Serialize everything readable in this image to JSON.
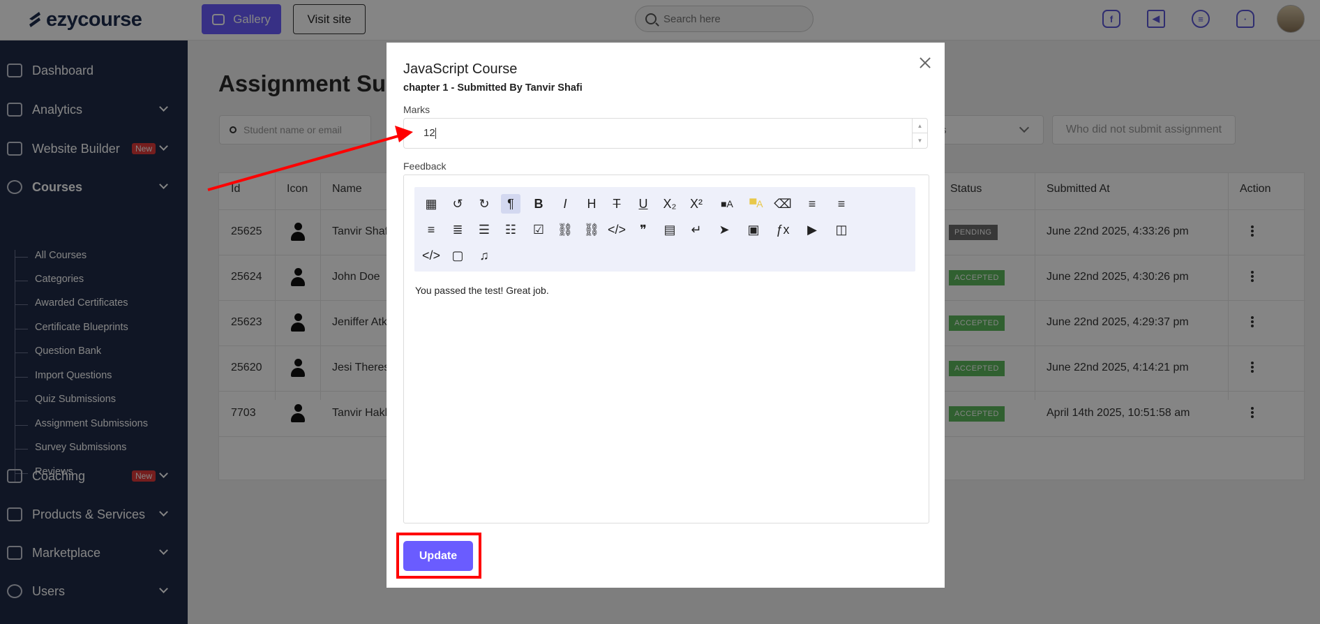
{
  "header": {
    "logo": "ezycourse",
    "gallery_label": "Gallery",
    "visit_label": "Visit site",
    "search_placeholder": "Search here",
    "icons": [
      "facebook-icon",
      "megaphone-icon",
      "chat-icon",
      "bell-icon"
    ]
  },
  "sidebar": {
    "items": [
      {
        "label": "Dashboard",
        "icon": "dashboard-icon"
      },
      {
        "label": "Analytics",
        "icon": "analytics-icon"
      },
      {
        "label": "Website Builder",
        "icon": "website-icon",
        "badge": "New"
      },
      {
        "label": "Courses",
        "icon": "courses-icon"
      },
      {
        "label": "Coaching",
        "icon": "coaching-icon",
        "badge": "New"
      },
      {
        "label": "Products & Services",
        "icon": "products-icon"
      },
      {
        "label": "Marketplace",
        "icon": "marketplace-icon"
      },
      {
        "label": "Users",
        "icon": "users-icon"
      }
    ],
    "course_subitems": [
      "All Courses",
      "Categories",
      "Awarded Certificates",
      "Certificate Blueprints",
      "Question Bank",
      "Import Questions",
      "Quiz Submissions",
      "Assignment Submissions",
      "Survey Submissions",
      "Reviews"
    ]
  },
  "main": {
    "title": "Assignment Subm",
    "filter_placeholder": "Student name or email",
    "filter_select": "s",
    "filter_button": "Who did not submit assignment",
    "table": {
      "headers": [
        "Id",
        "Icon",
        "Name",
        "Status",
        "Submitted At",
        "Action"
      ],
      "rows": [
        {
          "id": "25625",
          "name": "Tanvir Shafi",
          "status": "PENDING",
          "submitted": "June 22nd 2025, 4:33:26 pm"
        },
        {
          "id": "25624",
          "name": "John Doe",
          "status": "ACCEPTED",
          "submitted": "June 22nd 2025, 4:30:26 pm"
        },
        {
          "id": "25623",
          "name": "Jeniffer Atk",
          "status": "ACCEPTED",
          "submitted": "June 22nd 2025, 4:29:37 pm"
        },
        {
          "id": "25620",
          "name": "Jesi Theress",
          "status": "ACCEPTED",
          "submitted": "June 22nd 2025, 4:14:21 pm"
        },
        {
          "id": "7703",
          "name": "Tanvir Hakk",
          "status": "ACCEPTED",
          "submitted": "April 14th 2025, 10:51:58 am"
        }
      ]
    }
  },
  "modal": {
    "title": "JavaScript Course",
    "subtitle": "chapter 1 - Submitted By Tanvir Shafi",
    "marks_label": "Marks",
    "marks_value": "12",
    "feedback_label": "Feedback",
    "feedback_text": "You passed the test! Great job.",
    "update_label": "Update",
    "toolbar_buttons": [
      "table-icon",
      "undo-icon",
      "redo-icon",
      "paragraph-icon",
      "bold-icon",
      "italic-icon",
      "heading-icon",
      "strikethrough-icon",
      "underline-icon",
      "subscript-icon",
      "superscript-icon",
      "font-color-icon",
      "highlight-color-icon",
      "clear-format-icon",
      "align-left-icon",
      "align-center-icon",
      "align-right-icon",
      "align-justify-icon",
      "bullet-list-icon",
      "ordered-list-icon",
      "checklist-icon",
      "link-icon",
      "unlink-icon",
      "code-icon",
      "quote-icon",
      "page-break-icon",
      "line-break-icon",
      "send-icon",
      "image-icon",
      "formula-icon",
      "youtube-icon",
      "video-icon",
      "code-block-icon",
      "file-code-icon",
      "audio-icon"
    ],
    "toolbar_glyphs": [
      "▦",
      "↺",
      "↻",
      "¶",
      "B",
      "I",
      "H",
      "T",
      "U",
      "X₂",
      "X²",
      "■A",
      "▀A",
      "⌫",
      "≡",
      "≡",
      "≡",
      "≣",
      "☰",
      "☷",
      "☑",
      "⛓",
      "⛓",
      "</>",
      "❞",
      "▤",
      "↵",
      "➤",
      "▣",
      "ƒx",
      "▶",
      "◫",
      "</>",
      "▢",
      "♫"
    ]
  }
}
